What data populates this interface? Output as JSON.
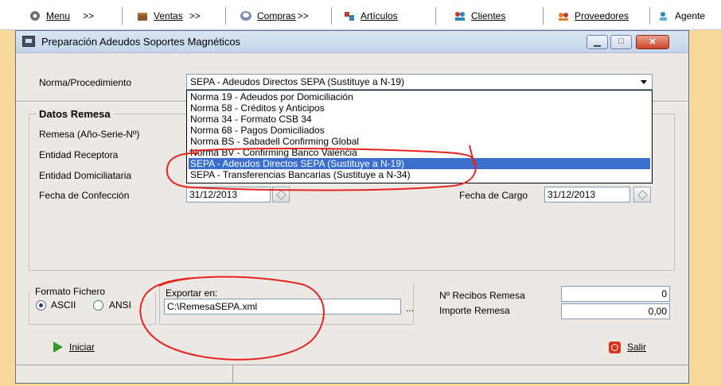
{
  "menubar": {
    "items": [
      {
        "label": "Menu",
        "suffix": ">>",
        "icon": "gear-icon"
      },
      {
        "label": "Ventas",
        "suffix": ">>",
        "icon": "box-icon"
      },
      {
        "label": "Compras",
        "suffix": ">>",
        "icon": "cart-icon"
      },
      {
        "label": "Artículos",
        "suffix": "",
        "icon": "articles-icon"
      },
      {
        "label": "Clientes",
        "suffix": "",
        "icon": "clients-icon"
      },
      {
        "label": "Proveedores",
        "suffix": "",
        "icon": "suppliers-icon"
      },
      {
        "label": "Agente",
        "suffix": "",
        "icon": "agent-icon"
      }
    ]
  },
  "window": {
    "title": "Preparación Adeudos Soportes Magnéticos"
  },
  "norma": {
    "label": "Norma/Procedimiento",
    "selected": "SEPA - Adeudos Directos SEPA (Sustituye a N-19)",
    "options": [
      "Norma 19 - Adeudos por Domiciliación",
      "Norma 58 - Créditos y Anticipos",
      "Norma 34 - Formato CSB 34",
      "Norma 68 - Pagos Domiciliados",
      "Norma BS - Sabadell Confirming Global",
      "Norma BV - Confirming Banco Valencia",
      "SEPA - Adeudos Directos SEPA (Sustituye a N-19)",
      "SEPA - Transferencias Bancarias (Sustituye a N-34)"
    ],
    "highlighted_index": 6
  },
  "remesa": {
    "heading": "Datos Remesa",
    "remesa_label": "Remesa (Año-Serie-Nº)",
    "entidad_receptora_label": "Entidad Receptora",
    "entidad_domiciliataria_label": "Entidad Domiciliataria",
    "fecha_confeccion_label": "Fecha de Confección",
    "fecha_confeccion_value": "31/12/2013",
    "fecha_cargo_label": "Fecha de Cargo",
    "fecha_cargo_value": "31/12/2013"
  },
  "formato": {
    "label": "Formato Fichero",
    "option_ascii": "ASCII",
    "option_ansi": "ANSI"
  },
  "exportar": {
    "label": "Exportar en:",
    "value": "C:\\RemesaSEPA.xml",
    "browse": "..."
  },
  "totales": {
    "recibos_label": "Nº Recibos Remesa",
    "recibos_value": "0",
    "importe_label": "Importe Remesa",
    "importe_value": "0,00"
  },
  "actions": {
    "iniciar": "Iniciar",
    "salir": "Salir"
  },
  "colors": {
    "background": "#f8d99a",
    "selection": "#3a6fd0",
    "annotation": "#e8231e"
  }
}
